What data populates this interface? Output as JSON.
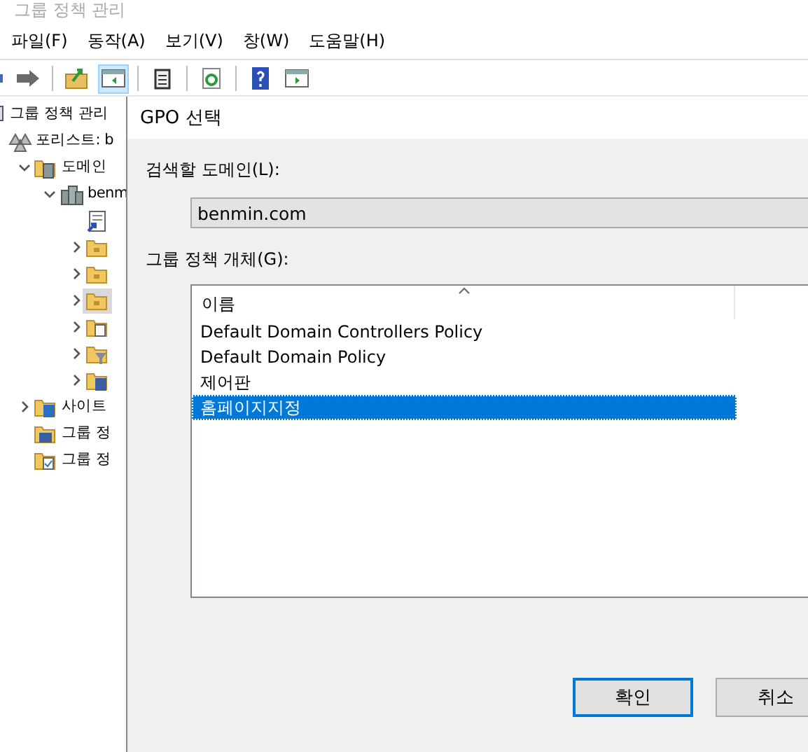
{
  "window": {
    "title": "그룹 정책 관리"
  },
  "menu": [
    "파일(F)",
    "동작(A)",
    "보기(V)",
    "창(W)",
    "도움말(H)"
  ],
  "toolbar": [
    {
      "kind": "back",
      "pressed": false
    },
    {
      "kind": "forward",
      "pressed": false
    },
    {
      "kind": "sep"
    },
    {
      "kind": "up",
      "pressed": false
    },
    {
      "kind": "tree",
      "pressed": true
    },
    {
      "kind": "sep"
    },
    {
      "kind": "clipboard",
      "pressed": false
    },
    {
      "kind": "sep"
    },
    {
      "kind": "refresh",
      "pressed": false
    },
    {
      "kind": "sep"
    },
    {
      "kind": "help",
      "pressed": false
    },
    {
      "kind": "panel",
      "pressed": false
    }
  ],
  "tree": [
    {
      "label": "그룹 정책 관리",
      "kind": "root",
      "selected": false,
      "children": [
        {
          "label": "포리스트: b",
          "kind": "forest",
          "selected": false,
          "children": [
            {
              "label": "도메인",
              "kind": "domains",
              "expanded": true,
              "selected": false,
              "children": [
                {
                  "label": "benm",
                  "kind": "server",
                  "expanded": true,
                  "selected": false,
                  "children": [
                    {
                      "kind": "gpo-link",
                      "selected": false
                    },
                    {
                      "kind": "folder",
                      "expanded": false,
                      "selected": false
                    },
                    {
                      "kind": "folder",
                      "expanded": false,
                      "selected": false
                    },
                    {
                      "kind": "folder",
                      "expanded": false,
                      "selected": true
                    },
                    {
                      "kind": "folder-doc",
                      "expanded": false,
                      "selected": false
                    },
                    {
                      "kind": "folder-filter",
                      "expanded": false,
                      "selected": false
                    },
                    {
                      "kind": "folder-list",
                      "expanded": false,
                      "selected": false
                    }
                  ]
                }
              ]
            },
            {
              "label": "사이트",
              "kind": "site",
              "expanded": false,
              "selected": false
            },
            {
              "label": "그룹 정",
              "kind": "modeling",
              "selected": false
            },
            {
              "label": "그룹 정",
              "kind": "results",
              "selected": false
            }
          ]
        }
      ]
    }
  ],
  "dialog": {
    "title": "GPO 선택",
    "domain_label": "검색할 도메인(L):",
    "domain_value": "benmin.com",
    "objects_label": "그룹 정책 개체(G):",
    "column": "이름",
    "rows": [
      {
        "name": "Default Domain Controllers Policy",
        "selected": false
      },
      {
        "name": "Default Domain Policy",
        "selected": false
      },
      {
        "name": "제어판",
        "selected": false
      },
      {
        "name": "홈페이지지정",
        "selected": true
      }
    ],
    "buttons": [
      {
        "label": "확인",
        "selected": true
      },
      {
        "label": "취소",
        "selected": false
      }
    ]
  }
}
